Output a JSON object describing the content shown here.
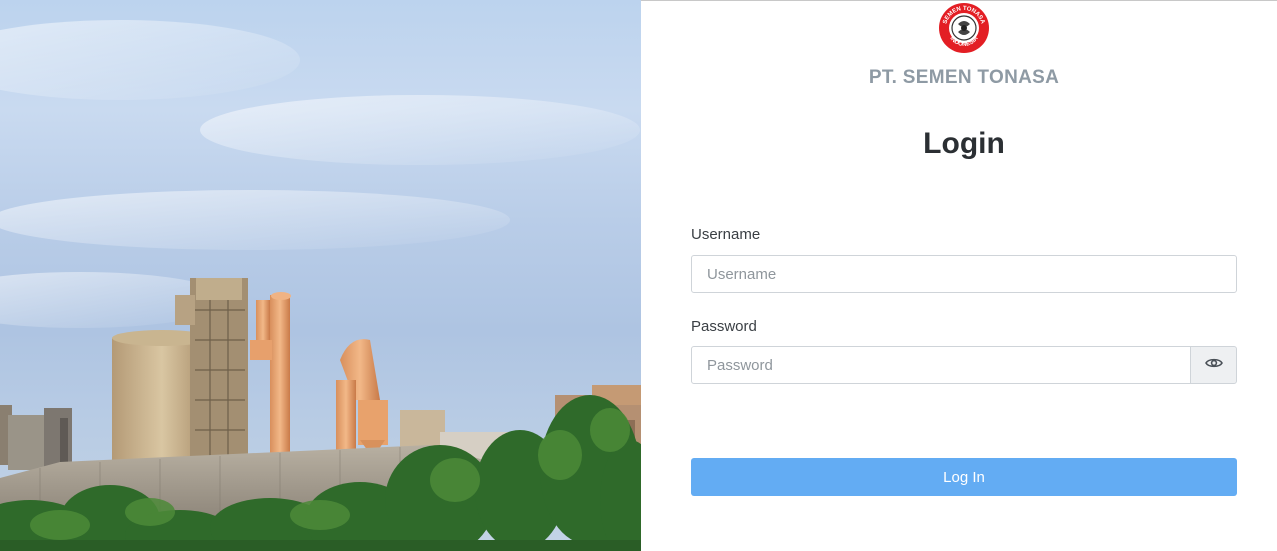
{
  "hero": {
    "description_icon": "cement-plant-photo"
  },
  "brand": {
    "logo_icon": "semen-tonasa-seal-icon",
    "logo_ring_text_top": "SEMEN TONASA",
    "logo_ring_text_bottom": "INDONESIA",
    "company_name": "PT. SEMEN TONASA",
    "accent_color": "#e31e24"
  },
  "login": {
    "title": "Login",
    "username": {
      "label": "Username",
      "value": "",
      "placeholder": "Username"
    },
    "password": {
      "label": "Password",
      "value": "",
      "placeholder": "Password",
      "toggle_icon": "eye-icon"
    },
    "submit_label": "Log In",
    "button_color": "#63acf3"
  }
}
